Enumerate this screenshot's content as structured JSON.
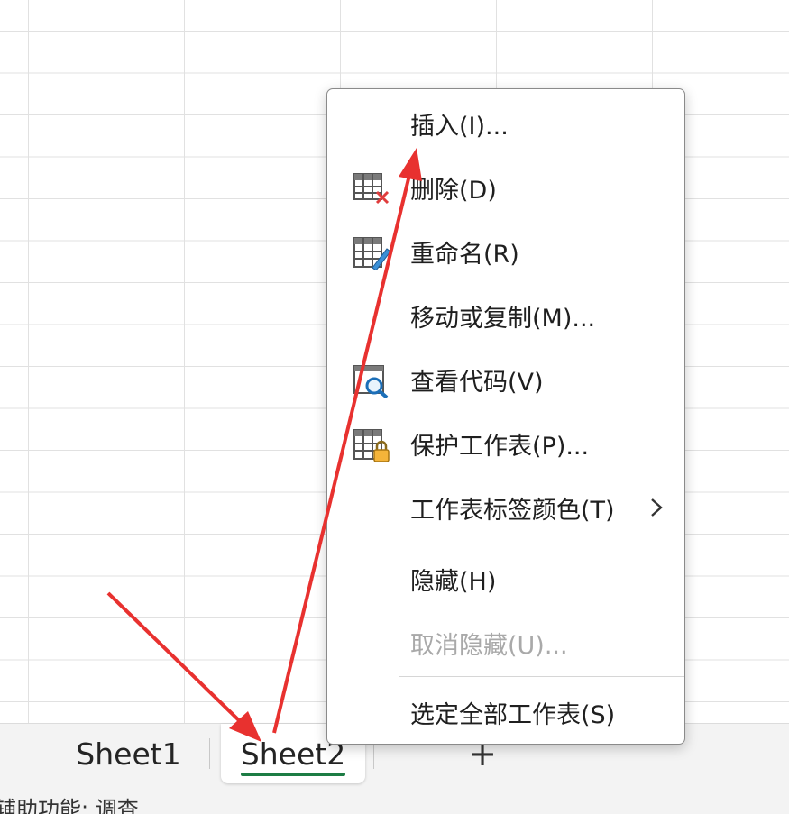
{
  "context_menu": {
    "items": [
      {
        "label": "插入(I)...",
        "icon": null,
        "enabled": true
      },
      {
        "label": "删除(D)",
        "icon": "sheet-delete-icon",
        "enabled": true
      },
      {
        "label": "重命名(R)",
        "icon": "sheet-rename-icon",
        "enabled": true
      },
      {
        "label": "移动或复制(M)...",
        "icon": null,
        "enabled": true
      },
      {
        "label": "查看代码(V)",
        "icon": "view-code-icon",
        "enabled": true
      },
      {
        "label": "保护工作表(P)...",
        "icon": "protect-sheet-icon",
        "enabled": true
      },
      {
        "label": "工作表标签颜色(T)",
        "icon": null,
        "enabled": true,
        "submenu": true
      },
      {
        "label": "隐藏(H)",
        "icon": null,
        "enabled": true
      },
      {
        "label": "取消隐藏(U)...",
        "icon": null,
        "enabled": false
      },
      {
        "label": "选定全部工作表(S)",
        "icon": null,
        "enabled": true
      }
    ]
  },
  "sheet_tabs": {
    "tabs": [
      {
        "label": "Sheet1",
        "active": false
      },
      {
        "label": "Sheet2",
        "active": true
      }
    ],
    "add_label": "+"
  },
  "status_bar": {
    "text": "辅助功能: 调查"
  },
  "colors": {
    "active_tab_underline": "#1d7c44",
    "annotation_arrow": "#e8312f"
  }
}
